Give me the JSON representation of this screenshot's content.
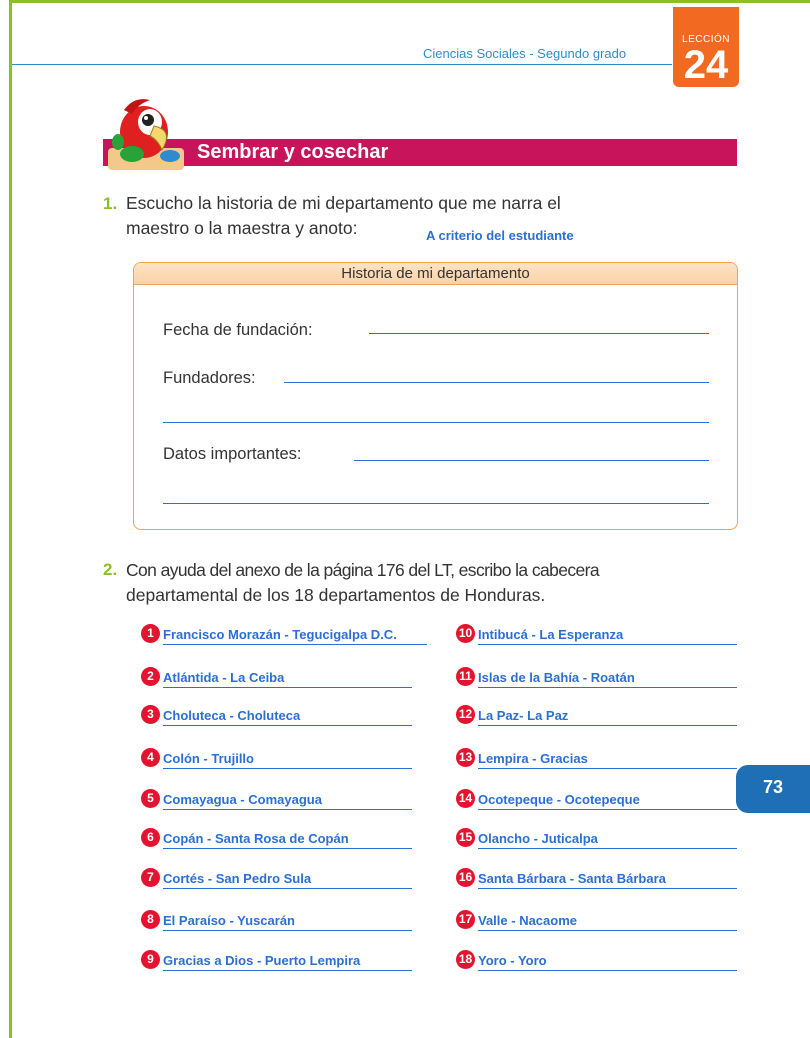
{
  "header": {
    "course": "Ciencias Sociales - Segundo grado",
    "lesson_label": "LECCIÓN",
    "lesson_number": "24"
  },
  "section": {
    "title": "Sembrar y cosechar"
  },
  "q1": {
    "number": "1.",
    "line1": "Escucho la historia de mi departamento que me narra el",
    "line2": "maestro o la maestra y anoto:",
    "answer": "A criterio del estudiante",
    "box_title": "Historia de mi departamento",
    "fields": {
      "fecha": "Fecha de fundación:",
      "fundadores": "Fundadores:",
      "datos": "Datos importantes:"
    }
  },
  "q2": {
    "number": "2.",
    "line1": "Con ayuda del anexo de la página 176 del LT, escribo la cabecera",
    "line2": "departamental de los 18 departamentos de Honduras."
  },
  "departments": [
    {
      "n": "1",
      "text": "Francisco Morazán - Tegucigalpa D.C."
    },
    {
      "n": "2",
      "text": "Atlántida - La Ceiba"
    },
    {
      "n": "3",
      "text": "Choluteca - Choluteca"
    },
    {
      "n": "4",
      "text": "Colón - Trujillo"
    },
    {
      "n": "5",
      "text": "Comayagua - Comayagua"
    },
    {
      "n": "6",
      "text": "Copán - Santa Rosa de Copán"
    },
    {
      "n": "7",
      "text": "Cortés - San Pedro Sula"
    },
    {
      "n": "8",
      "text": "El Paraíso - Yuscarán"
    },
    {
      "n": "9",
      "text": "Gracias a Dios - Puerto Lempira"
    },
    {
      "n": "10",
      "text": "Intibucá - La Esperanza"
    },
    {
      "n": "11",
      "text": "Islas de la Bahía - Roatán"
    },
    {
      "n": "12",
      "text": "La Paz- La Paz"
    },
    {
      "n": "13",
      "text": "Lempira - Gracias"
    },
    {
      "n": "14",
      "text": "Ocotepeque - Ocotepeque"
    },
    {
      "n": "15",
      "text": "Olancho - Juticalpa"
    },
    {
      "n": "16",
      "text": "Santa Bárbara - Santa Bárbara"
    },
    {
      "n": "17",
      "text": "Valle - Nacaome"
    },
    {
      "n": "18",
      "text": "Yoro - Yoro"
    }
  ],
  "footer": {
    "page_number": "73"
  },
  "colors": {
    "frame": "#8cbf26",
    "accent_blue": "#2a6fd6",
    "section_magenta": "#c8145a",
    "lesson_orange": "#f26a21",
    "badge_red": "#e4132f",
    "page_blue": "#1e6fb6"
  }
}
